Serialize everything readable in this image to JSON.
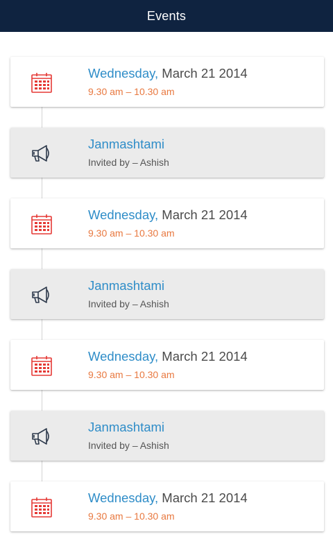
{
  "header": {
    "title": "Events"
  },
  "colors": {
    "header_bg": "#0f2340",
    "accent_blue": "#2f8dc8",
    "accent_orange": "#e8783f",
    "calendar_red": "#e53935",
    "invite_card_bg": "#ebebeb"
  },
  "items": [
    {
      "type": "date",
      "icon": "calendar-icon",
      "day": "Wednesday,",
      "date": " March 21 2014",
      "time": "9.30 am – 10.30 am"
    },
    {
      "type": "invite",
      "icon": "megaphone-icon",
      "name": "Janmashtami",
      "invited": "Invited by – Ashish"
    },
    {
      "type": "date",
      "icon": "calendar-icon",
      "day": "Wednesday,",
      "date": " March 21 2014",
      "time": "9.30 am – 10.30 am"
    },
    {
      "type": "invite",
      "icon": "megaphone-icon",
      "name": "Janmashtami",
      "invited": "Invited by – Ashish"
    },
    {
      "type": "date",
      "icon": "calendar-icon",
      "day": "Wednesday,",
      "date": " March 21 2014",
      "time": "9.30 am – 10.30 am"
    },
    {
      "type": "invite",
      "icon": "megaphone-icon",
      "name": "Janmashtami",
      "invited": "Invited by – Ashish"
    },
    {
      "type": "date",
      "icon": "calendar-icon",
      "day": "Wednesday,",
      "date": " March 21 2014",
      "time": "9.30 am – 10.30 am"
    }
  ]
}
